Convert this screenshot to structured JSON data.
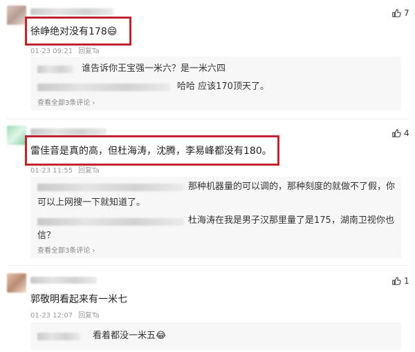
{
  "comments": [
    {
      "text": "徐峥绝对没有178😄",
      "time": "01-23 09:21",
      "reply_label": "回复Ta",
      "likes": "7",
      "replies": [
        {
          "text": "谁告诉你王宝强一米六？是一米六四"
        },
        {
          "text": "哈哈 应该170顶天了。"
        }
      ],
      "more": "查看全部3条评论 ›"
    },
    {
      "text": "雷佳音是真的高，但杜海涛，沈腾，李易峰都没有180。",
      "time": "01-23 11:55",
      "reply_label": "回复Ta",
      "likes": "4",
      "replies": [
        {
          "line1": "那种机器量的可以调的，那种刻度的就做不了假，你",
          "line2": "可以上网搜一下就知道了。"
        },
        {
          "line1": "杜海涛在我是男子汉那里量了是175，湖南卫视你也",
          "line2": "信？"
        }
      ],
      "more": "查看全部3条评论 ›"
    },
    {
      "text": "郭敬明看起来有一米七",
      "time": "01-23 12:07",
      "reply_label": "回复Ta",
      "likes": "1",
      "replies": [
        {
          "text": "看着都没一米五😂"
        }
      ]
    }
  ],
  "colors": {
    "highlight": "#c0232c",
    "reply_bg": "#f7f7f7"
  },
  "icons": {
    "like": "thumbs-up-icon"
  }
}
